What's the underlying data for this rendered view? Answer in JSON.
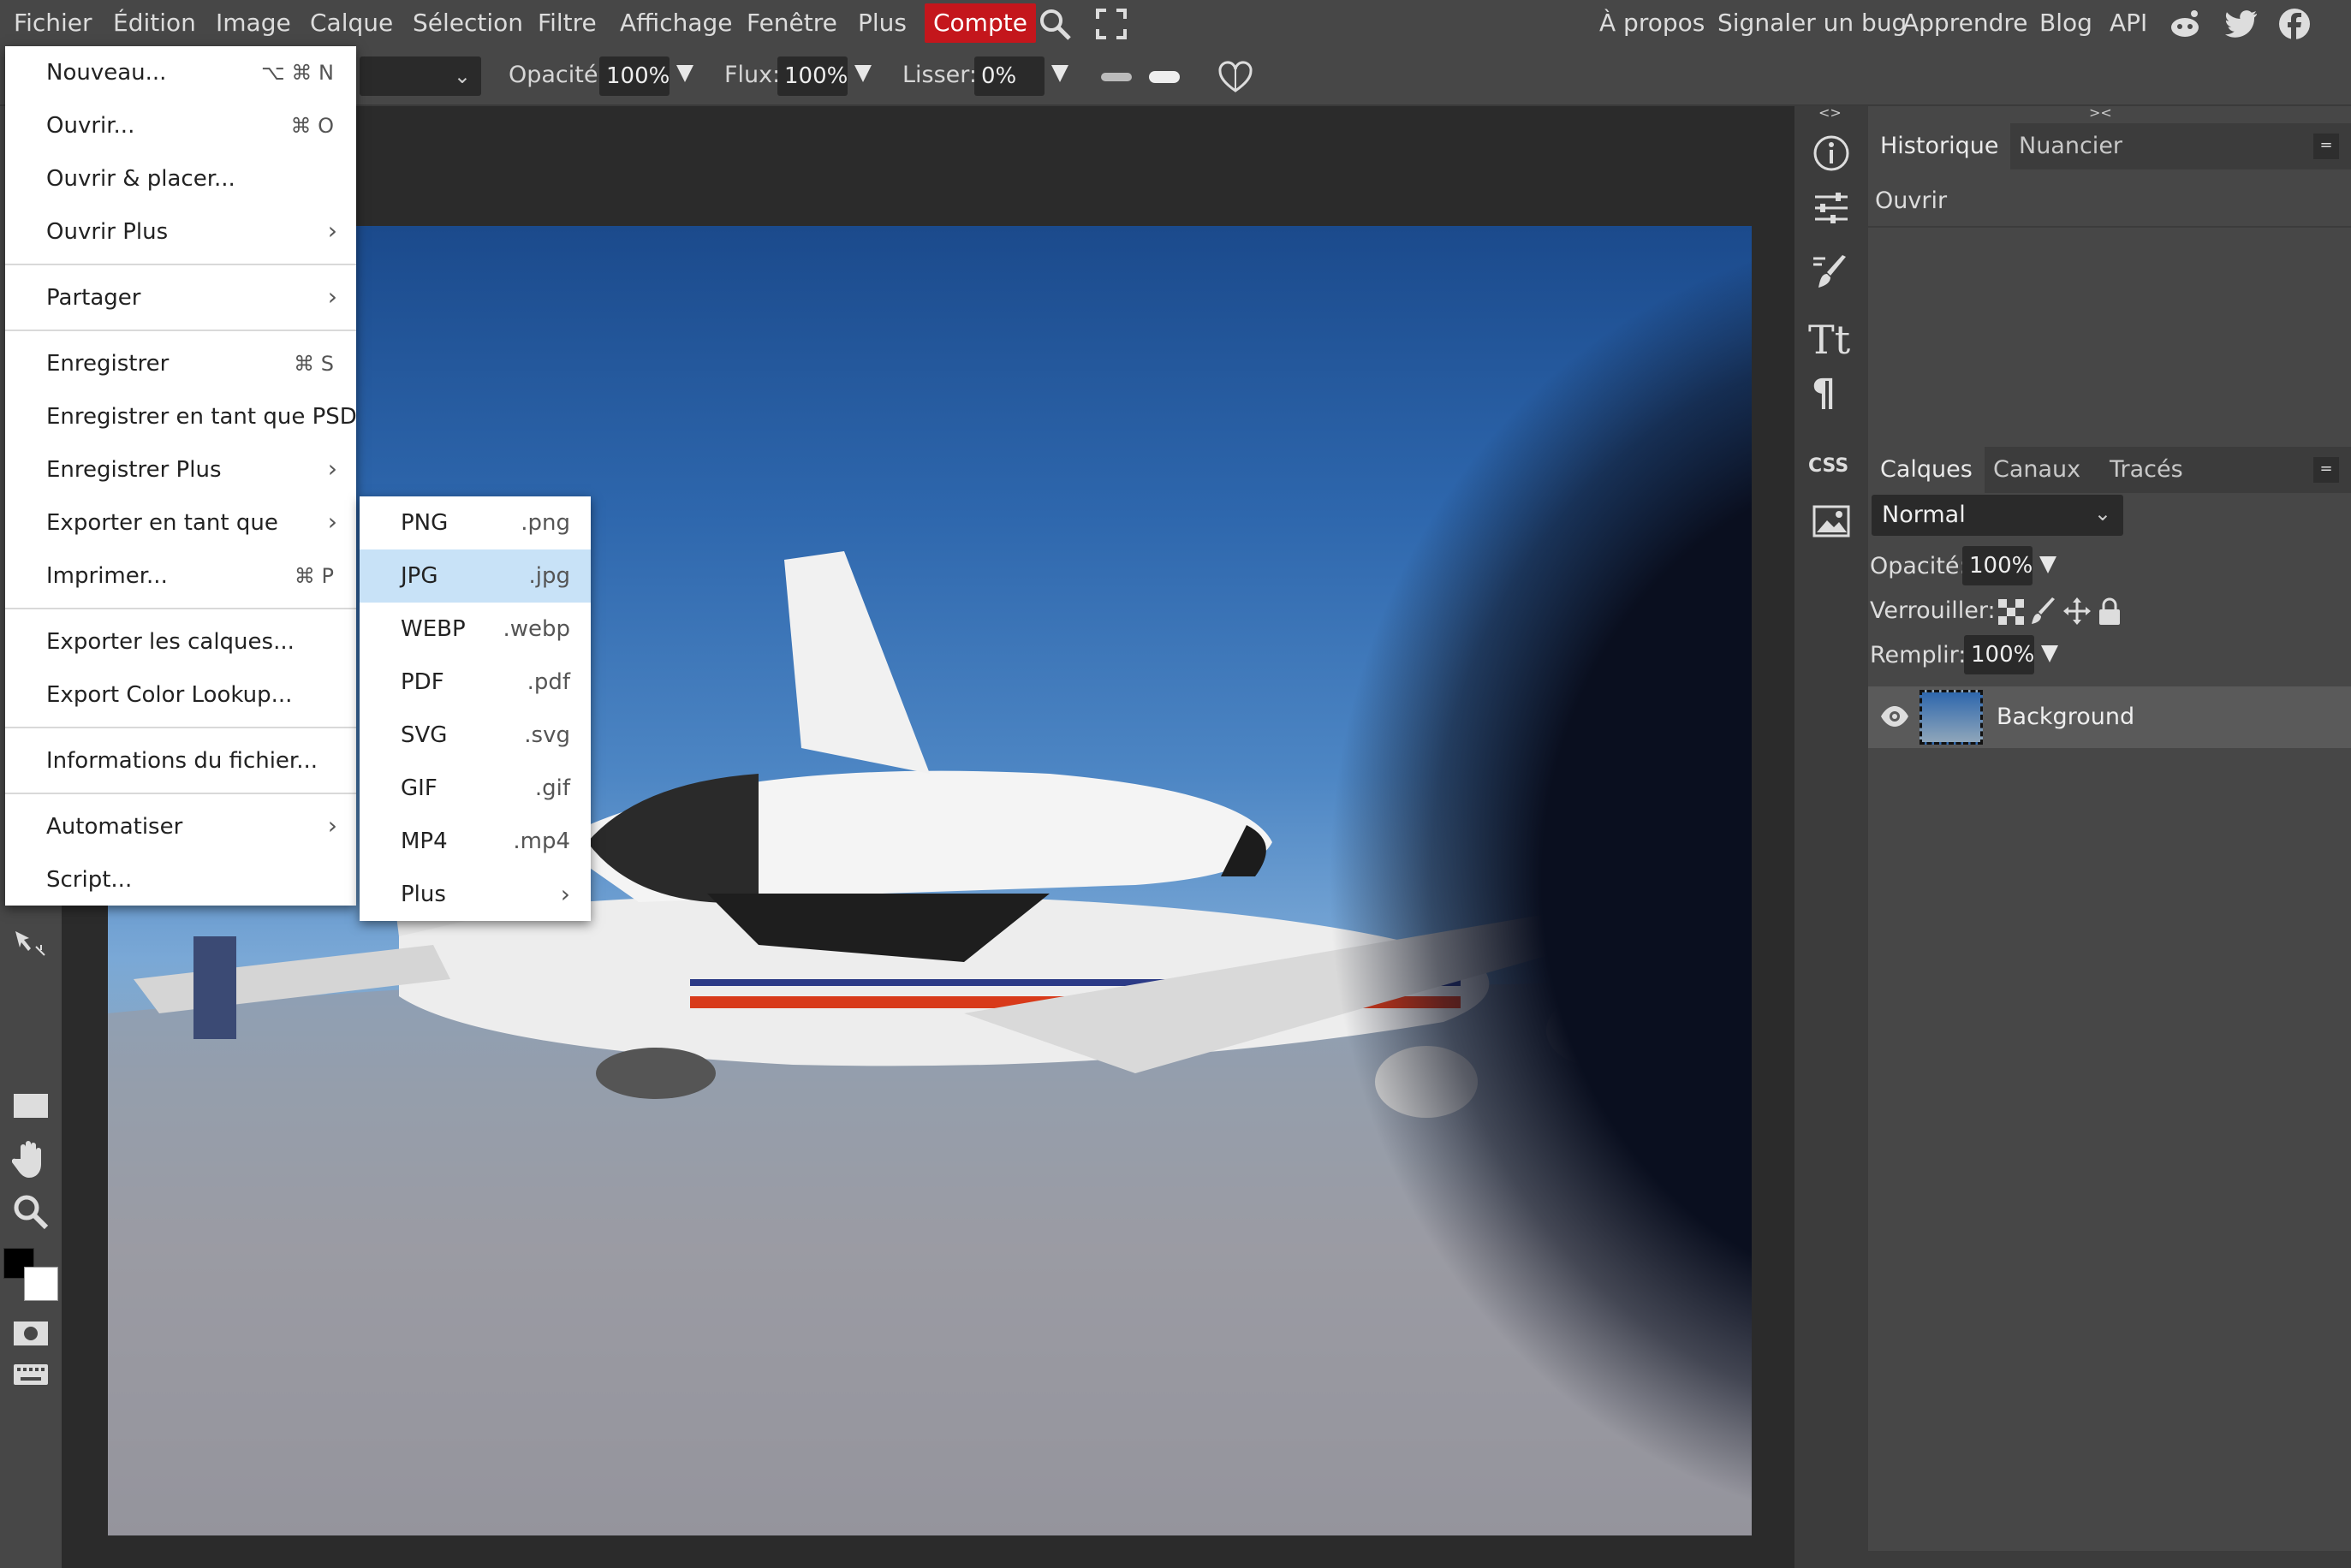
{
  "menubar": {
    "items": [
      "Fichier",
      "Édition",
      "Image",
      "Calque",
      "Sélection",
      "Filtre",
      "Affichage",
      "Fenêtre",
      "Plus"
    ],
    "account": "Compte",
    "right_links": [
      "À propos",
      "Signaler un bug",
      "Apprendre",
      "Blog",
      "API"
    ]
  },
  "options": {
    "opacity_label": "Opacité:",
    "opacity_value": "100%",
    "flow_label": "Flux:",
    "flow_value": "100%",
    "smooth_label": "Lisser:",
    "smooth_value": "0%"
  },
  "file_menu": {
    "new": {
      "label": "Nouveau...",
      "shortcut": "⌥ ⌘ N"
    },
    "open": {
      "label": "Ouvrir...",
      "shortcut": "⌘ O"
    },
    "open_place": {
      "label": "Ouvrir & placer..."
    },
    "open_more": {
      "label": "Ouvrir Plus"
    },
    "share": {
      "label": "Partager"
    },
    "save": {
      "label": "Enregistrer",
      "shortcut": "⌘ S"
    },
    "save_psd": {
      "label": "Enregistrer en tant que PSD"
    },
    "save_more": {
      "label": "Enregistrer Plus"
    },
    "export_as": {
      "label": "Exporter en tant que"
    },
    "print": {
      "label": "Imprimer...",
      "shortcut": "⌘ P"
    },
    "export_layers": {
      "label": "Exporter les calques..."
    },
    "export_lookup": {
      "label": "Export Color Lookup..."
    },
    "file_info": {
      "label": "Informations du fichier..."
    },
    "automate": {
      "label": "Automatiser"
    },
    "script": {
      "label": "Script..."
    }
  },
  "export_menu": [
    {
      "label": "PNG",
      "ext": ".png"
    },
    {
      "label": "JPG",
      "ext": ".jpg"
    },
    {
      "label": "WEBP",
      "ext": ".webp"
    },
    {
      "label": "PDF",
      "ext": ".pdf"
    },
    {
      "label": "SVG",
      "ext": ".svg"
    },
    {
      "label": "GIF",
      "ext": ".gif"
    },
    {
      "label": "MP4",
      "ext": ".mp4"
    },
    {
      "label": "Plus",
      "ext": ""
    }
  ],
  "history_panel": {
    "tabs": [
      "Historique",
      "Nuancier"
    ],
    "items": [
      "Ouvrir"
    ]
  },
  "layers_panel": {
    "tabs": [
      "Calques",
      "Canaux",
      "Tracés"
    ],
    "blend_mode": "Normal",
    "opacity_label": "Opacité:",
    "opacity_value": "100%",
    "lock_label": "Verrouiller:",
    "fill_label": "Remplir:",
    "fill_value": "100%",
    "layers": [
      "Background"
    ]
  },
  "dock": {
    "css_label": "CSS"
  },
  "colors": {
    "accent_red": "#c4161c",
    "highlight": "#c8e2f7",
    "panel_bg": "#474747",
    "canvas_bg": "#2b2b2b"
  }
}
